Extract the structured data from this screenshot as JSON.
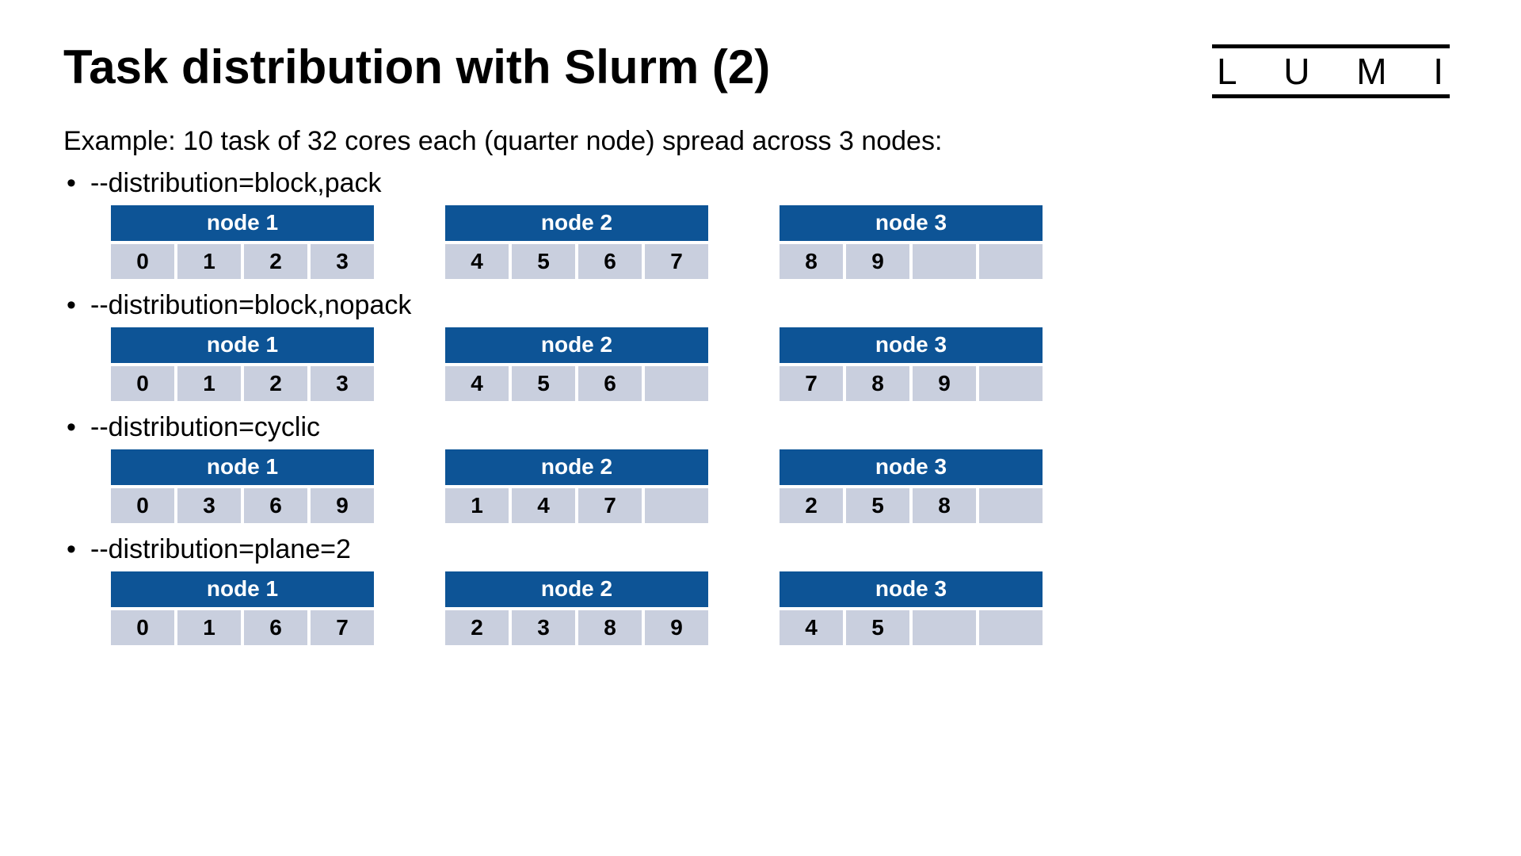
{
  "title": "Task distribution with Slurm (2)",
  "logo_letters": [
    "L",
    "U",
    "M",
    "I"
  ],
  "example_text": "Example: 10 task of 32 cores each (quarter node) spread across 3 nodes:",
  "distributions": [
    {
      "label": "--distribution=block,pack",
      "nodes": [
        {
          "header": "node 1",
          "cells": [
            "0",
            "1",
            "2",
            "3"
          ]
        },
        {
          "header": "node 2",
          "cells": [
            "4",
            "5",
            "6",
            "7"
          ]
        },
        {
          "header": "node 3",
          "cells": [
            "8",
            "9",
            "",
            ""
          ]
        }
      ]
    },
    {
      "label": "--distribution=block,nopack",
      "nodes": [
        {
          "header": "node 1",
          "cells": [
            "0",
            "1",
            "2",
            "3"
          ]
        },
        {
          "header": "node 2",
          "cells": [
            "4",
            "5",
            "6",
            ""
          ]
        },
        {
          "header": "node 3",
          "cells": [
            "7",
            "8",
            "9",
            ""
          ]
        }
      ]
    },
    {
      "label": "--distribution=cyclic",
      "nodes": [
        {
          "header": "node 1",
          "cells": [
            "0",
            "3",
            "6",
            "9"
          ]
        },
        {
          "header": "node 2",
          "cells": [
            "1",
            "4",
            "7",
            ""
          ]
        },
        {
          "header": "node 3",
          "cells": [
            "2",
            "5",
            "8",
            ""
          ]
        }
      ]
    },
    {
      "label": "--distribution=plane=2",
      "nodes": [
        {
          "header": "node 1",
          "cells": [
            "0",
            "1",
            "6",
            "7"
          ]
        },
        {
          "header": "node 2",
          "cells": [
            "2",
            "3",
            "8",
            "9"
          ]
        },
        {
          "header": "node 3",
          "cells": [
            "4",
            "5",
            "",
            ""
          ]
        }
      ]
    }
  ]
}
